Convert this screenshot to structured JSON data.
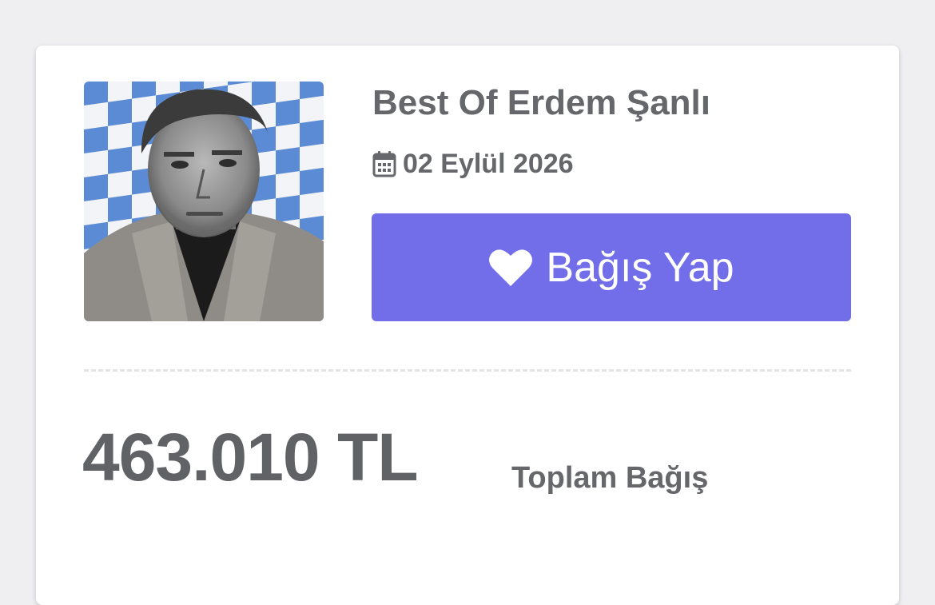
{
  "event": {
    "title": "Best Of Erdem Şanlı",
    "date": "02 Eylül 2026",
    "date_icon": "calendar-icon"
  },
  "donate_button": {
    "label": "Bağış Yap",
    "icon": "heart-icon",
    "color": "#726de8"
  },
  "stats": {
    "total_amount": "463.010 TL",
    "total_label": "Toplam Bağış"
  },
  "colors": {
    "text": "#66676b",
    "checker_blue": "#5b8fd6"
  }
}
